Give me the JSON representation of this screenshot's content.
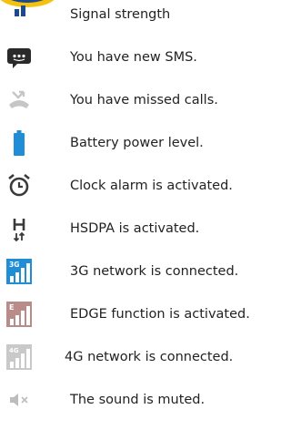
{
  "accent_colors": {
    "text": "#222222",
    "sms_icon": "#2a2a2a",
    "battery_icon": "#1f8ed6",
    "network_3g_icon": "#1f8ed6",
    "network_edge_icon": "#b98b89",
    "network_4g_icon": "#c9c9c9",
    "logo_yellow": "#f4c10f",
    "logo_blue": "#1d4a8f"
  },
  "rows": [
    {
      "icon": "signal-logo-icon",
      "label": "Signal strength"
    },
    {
      "icon": "sms-icon",
      "label": "You have new SMS."
    },
    {
      "icon": "missed-call-icon",
      "label": "You have missed calls."
    },
    {
      "icon": "battery-icon",
      "label": "Battery power level."
    },
    {
      "icon": "alarm-clock-icon",
      "label": "Clock alarm is activated."
    },
    {
      "icon": "hsdpa-icon",
      "label": "HSDPA is activated."
    },
    {
      "icon": "network-3g-icon",
      "label": "3G network is connected."
    },
    {
      "icon": "network-edge-icon",
      "label": "EDGE function is activated."
    },
    {
      "icon": "network-4g-icon",
      "label": "4G network is connected."
    },
    {
      "icon": "sound-muted-icon",
      "label": "The sound is muted."
    }
  ]
}
